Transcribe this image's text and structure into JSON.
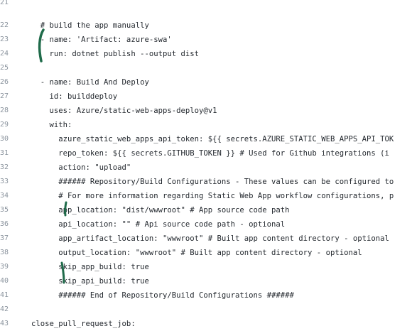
{
  "editor": {
    "lines": [
      {
        "num": "21",
        "text": ""
      },
      {
        "num": "22",
        "text": "  # build the app manually"
      },
      {
        "num": "23",
        "text": "  - name: 'Artifact: azure-swa'"
      },
      {
        "num": "24",
        "text": "    run: dotnet publish --output dist"
      },
      {
        "num": "25",
        "text": ""
      },
      {
        "num": "26",
        "text": "  - name: Build And Deploy"
      },
      {
        "num": "27",
        "text": "    id: builddeploy"
      },
      {
        "num": "28",
        "text": "    uses: Azure/static-web-apps-deploy@v1"
      },
      {
        "num": "29",
        "text": "    with:"
      },
      {
        "num": "30",
        "text": "      azure_static_web_apps_api_token: ${{ secrets.AZURE_STATIC_WEB_APPS_API_TOK"
      },
      {
        "num": "31",
        "text": "      repo_token: ${{ secrets.GITHUB_TOKEN }} # Used for Github integrations (i"
      },
      {
        "num": "32",
        "text": "      action: \"upload\""
      },
      {
        "num": "33",
        "text": "      ###### Repository/Build Configurations - These values can be configured to"
      },
      {
        "num": "34",
        "text": "      # For more information regarding Static Web App workflow configurations, p"
      },
      {
        "num": "35",
        "text": "      app_location: \"dist/wwwroot\" # App source code path"
      },
      {
        "num": "36",
        "text": "      api_location: \"\" # Api source code path - optional"
      },
      {
        "num": "37",
        "text": "      app_artifact_location: \"wwwroot\" # Built app content directory - optional"
      },
      {
        "num": "38",
        "text": "      output_location: \"wwwroot\" # Built app content directory - optional"
      },
      {
        "num": "39",
        "text": "      skip_app_build: true"
      },
      {
        "num": "40",
        "text": "      skip_api_build: true"
      },
      {
        "num": "41",
        "text": "      ###### End of Repository/Build Configurations ######"
      },
      {
        "num": "42",
        "text": ""
      },
      {
        "num": "43",
        "text": "close_pull_request_job:"
      }
    ]
  },
  "annotations": {
    "color": "#1f6b4a"
  }
}
